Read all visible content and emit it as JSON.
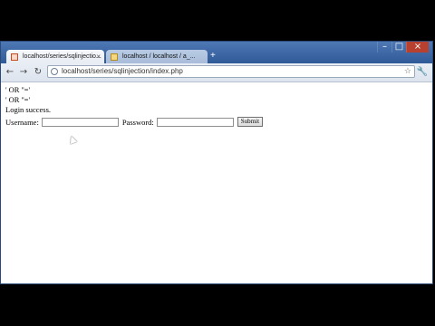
{
  "window": {
    "tabs": [
      {
        "label": "localhost/series/sqlinjectio...",
        "close": "×"
      },
      {
        "label": "localhost / localhost / a_..."
      }
    ],
    "new_tab": "+",
    "controls": {
      "minimize": "–",
      "maximize": "□",
      "close": "×"
    }
  },
  "toolbar": {
    "back": "←",
    "forward": "→",
    "reload": "↻",
    "url": "localhost/series/sqlinjection/index.php",
    "star": "☆",
    "wrench": "🔧"
  },
  "page": {
    "lines": [
      "' OR ''='",
      "' OR ''='",
      "Login success."
    ],
    "form": {
      "username_label": "Username:",
      "username_value": "",
      "password_label": "Password:",
      "password_value": "",
      "submit_label": "Submit"
    }
  }
}
